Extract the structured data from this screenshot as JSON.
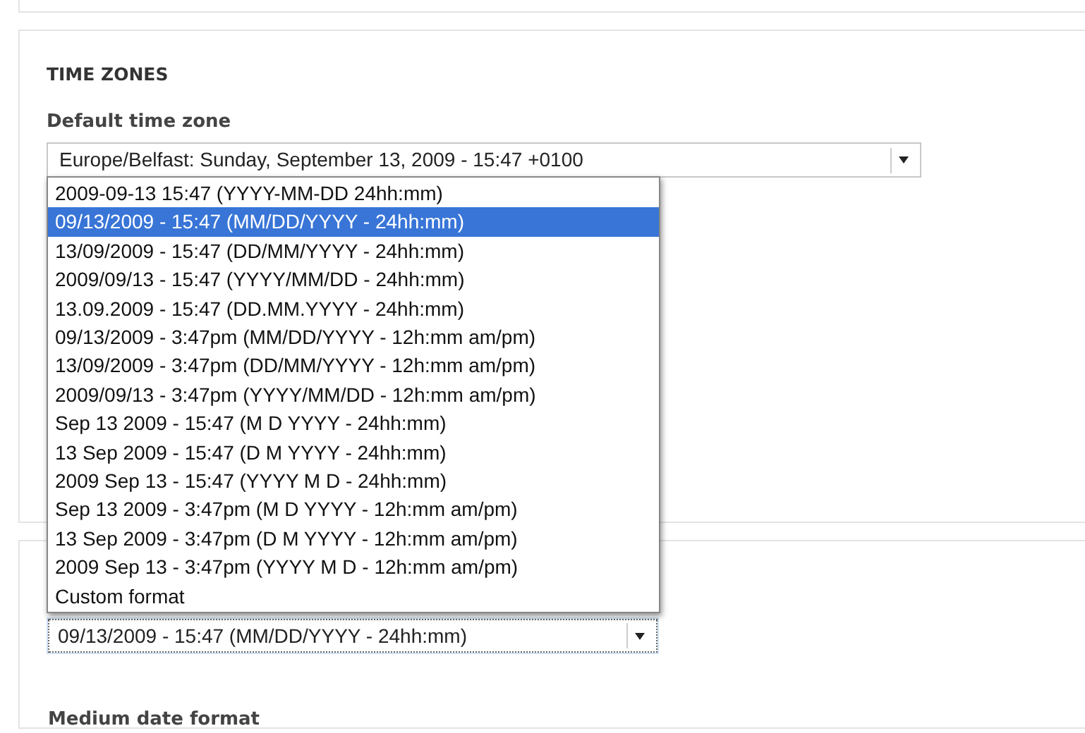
{
  "time_zones": {
    "heading": "TIME ZONES",
    "default_time_zone": {
      "label": "Default time zone",
      "value": "Europe/Belfast: Sunday, September 13, 2009 - 15:47 +0100"
    }
  },
  "date_format": {
    "value": "09/13/2009 - 15:47 (MM/DD/YYYY - 24hh:mm)",
    "options": [
      {
        "label": "2009-09-13 15:47 (YYYY-MM-DD 24hh:mm)",
        "selected": false
      },
      {
        "label": "09/13/2009 - 15:47 (MM/DD/YYYY - 24hh:mm)",
        "selected": true
      },
      {
        "label": "13/09/2009 - 15:47 (DD/MM/YYYY - 24hh:mm)",
        "selected": false
      },
      {
        "label": "2009/09/13 - 15:47 (YYYY/MM/DD - 24hh:mm)",
        "selected": false
      },
      {
        "label": "13.09.2009 - 15:47 (DD.MM.YYYY - 24hh:mm)",
        "selected": false
      },
      {
        "label": "09/13/2009 - 3:47pm (MM/DD/YYYY - 12h:mm am/pm)",
        "selected": false
      },
      {
        "label": "13/09/2009 - 3:47pm (DD/MM/YYYY - 12h:mm am/pm)",
        "selected": false
      },
      {
        "label": "2009/09/13 - 3:47pm (YYYY/MM/DD - 12h:mm am/pm)",
        "selected": false
      },
      {
        "label": "Sep 13 2009 - 15:47 (M D YYYY - 24hh:mm)",
        "selected": false
      },
      {
        "label": "13 Sep 2009 - 15:47 (D M YYYY - 24hh:mm)",
        "selected": false
      },
      {
        "label": "2009 Sep 13 - 15:47 (YYYY M D - 24hh:mm)",
        "selected": false
      },
      {
        "label": "Sep 13 2009 - 3:47pm (M D YYYY - 12h:mm am/pm)",
        "selected": false
      },
      {
        "label": "13 Sep 2009 - 3:47pm (D M YYYY - 12h:mm am/pm)",
        "selected": false
      },
      {
        "label": "2009 Sep 13 - 3:47pm (YYYY M D - 12h:mm am/pm)",
        "selected": false
      },
      {
        "label": "Custom format",
        "selected": false
      }
    ]
  },
  "medium_date_format": {
    "label": "Medium date format"
  }
}
